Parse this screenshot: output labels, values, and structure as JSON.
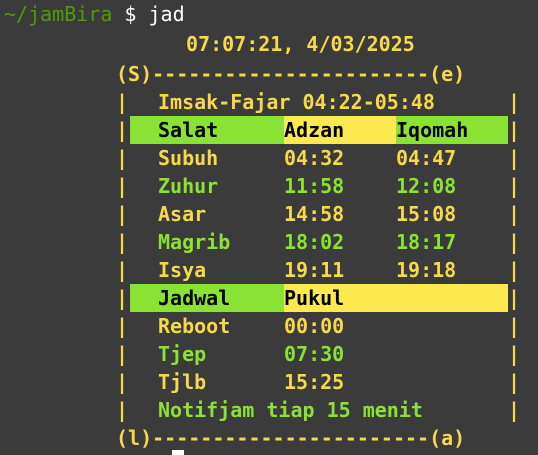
{
  "prompt": {
    "path": "~/jamBira",
    "symbol": "$",
    "command": "jad"
  },
  "datetime": "07:07:21, 4/03/2025",
  "frame": {
    "top": "(S)-----------------------(e)",
    "bottom": "(l)-----------------------(a)",
    "side": "|"
  },
  "imsak": "Imsak-Fajar 04:22-05:48",
  "salat_header": {
    "col1": "Salat",
    "col2": "Adzan",
    "col3": "Iqomah"
  },
  "salat_rows": [
    {
      "name": "Subuh",
      "adzan": "04:32",
      "iqomah": "04:47"
    },
    {
      "name": "Zuhur",
      "adzan": "11:58",
      "iqomah": "12:08"
    },
    {
      "name": "Asar",
      "adzan": "14:58",
      "iqomah": "15:08"
    },
    {
      "name": "Magrib",
      "adzan": "18:02",
      "iqomah": "18:17"
    },
    {
      "name": "Isya",
      "adzan": "19:11",
      "iqomah": "19:18"
    }
  ],
  "jadwal_header": {
    "col1": "Jadwal",
    "col2": "Pukul"
  },
  "jadwal_rows": [
    {
      "name": "Reboot",
      "time": "00:00"
    },
    {
      "name": "Tjep",
      "time": "07:30"
    },
    {
      "name": "Tjlb",
      "time": "15:25"
    }
  ],
  "notif": "Notifjam tiap 15 menit",
  "colors": {
    "background": "#3b3b3b",
    "yellow_text": "#f6d94b",
    "green_text": "#8ae234",
    "prompt_green": "#4f9a06",
    "header_green_bg": "#8ae234",
    "header_yellow_bg": "#fce94f"
  }
}
